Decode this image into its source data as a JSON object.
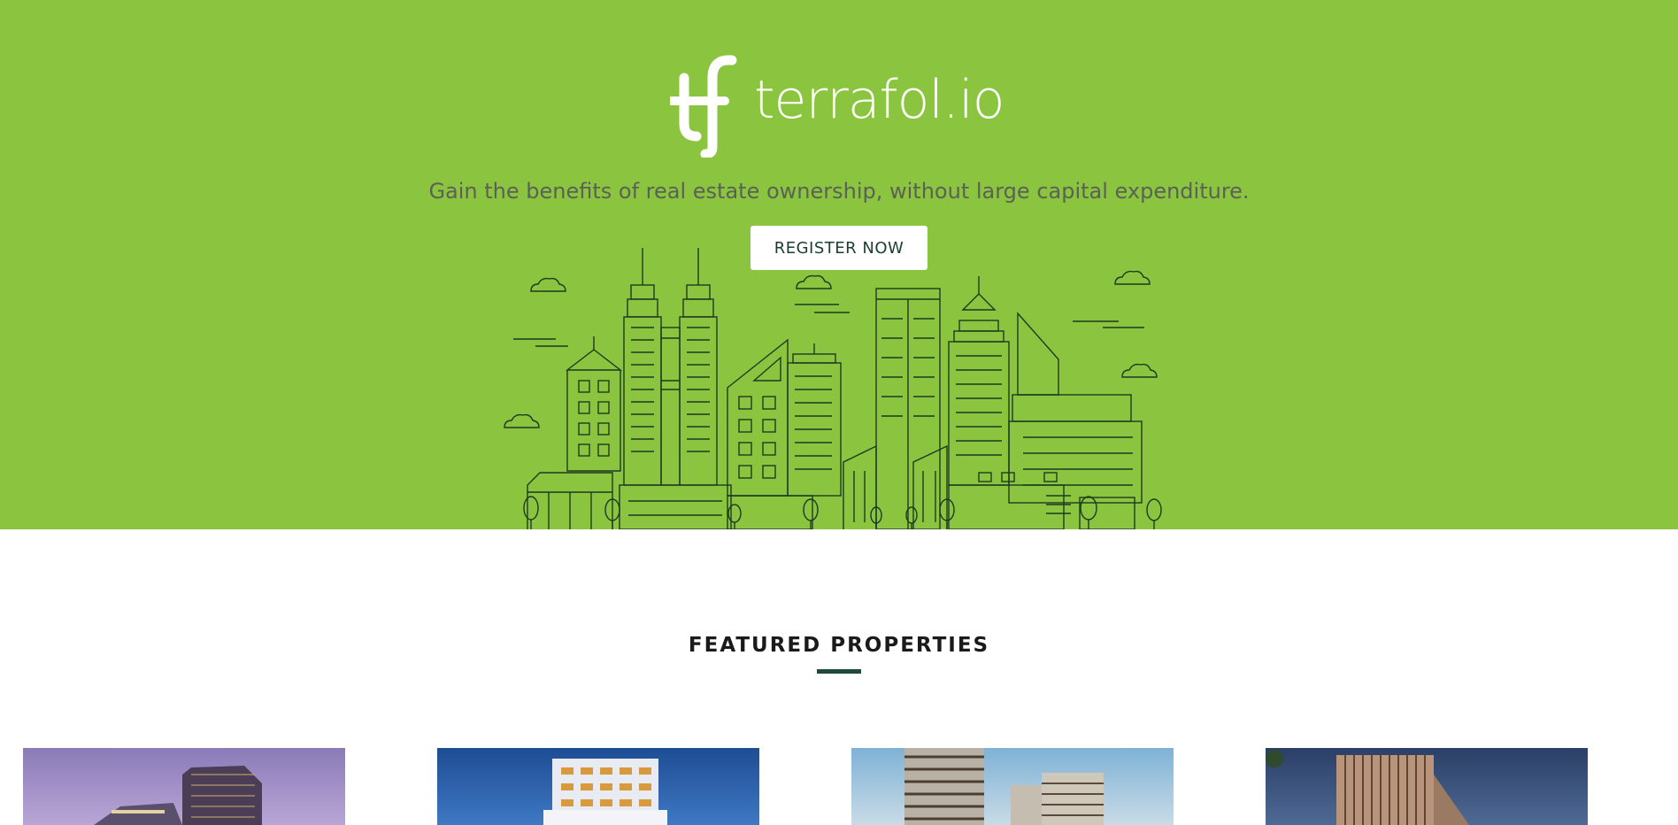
{
  "brand": {
    "name": "terrafol.io",
    "logo_mark": "tf-monogram",
    "accent": "#8bc53f"
  },
  "hero": {
    "tagline": "Gain the benefits of real estate ownership, without large capital expenditure.",
    "cta_label": "REGISTER NOW"
  },
  "featured": {
    "title": "FEATURED PROPERTIES",
    "cards": [
      {
        "image": "purple dusk tower"
      },
      {
        "image": "blue night apartment"
      },
      {
        "image": "daylight towers"
      },
      {
        "image": "evening brick building"
      }
    ]
  }
}
